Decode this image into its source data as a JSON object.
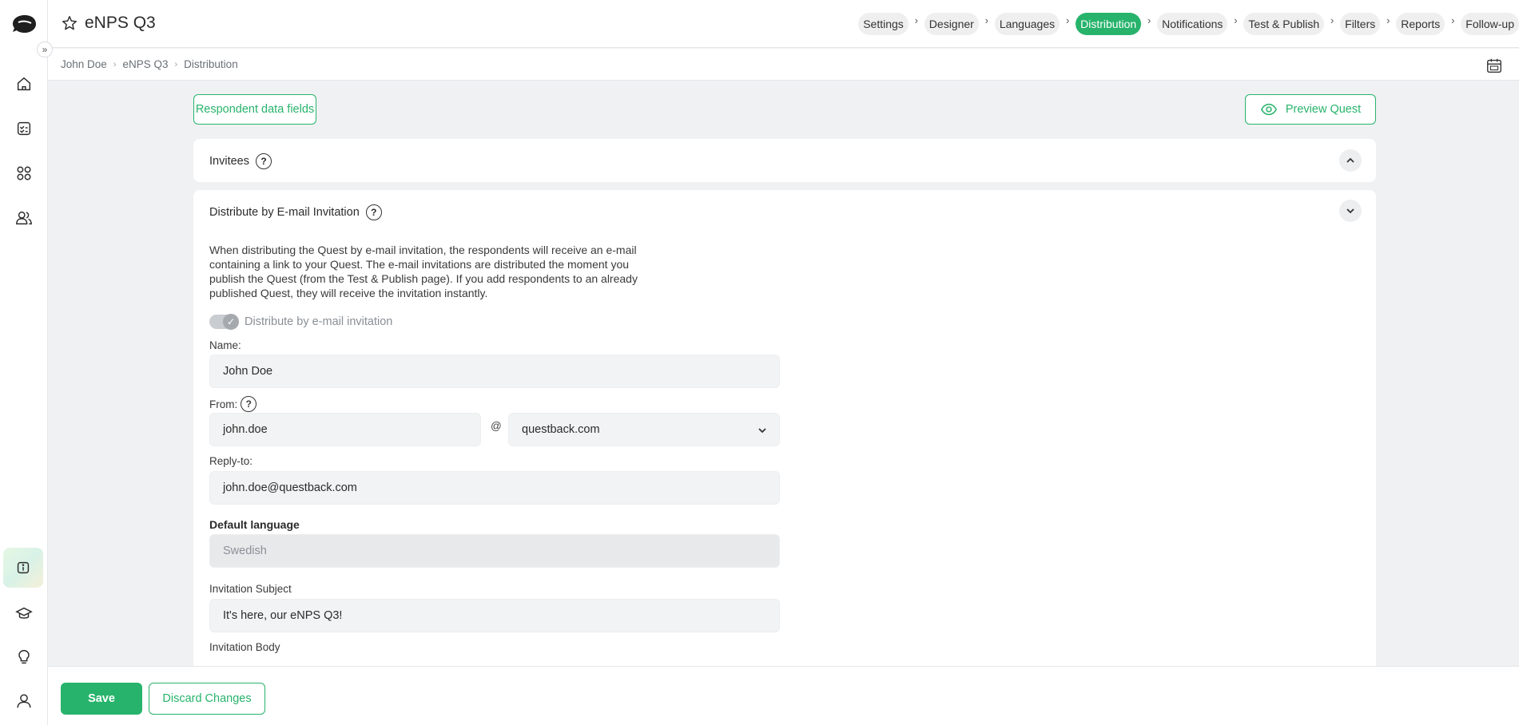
{
  "app": {
    "title": "eNPS Q3",
    "steps": [
      {
        "label": "Settings",
        "active": false
      },
      {
        "label": "Designer",
        "active": false
      },
      {
        "label": "Languages",
        "active": false
      },
      {
        "label": "Distribution",
        "active": true
      },
      {
        "label": "Notifications",
        "active": false
      },
      {
        "label": "Test & Publish",
        "active": false
      },
      {
        "label": "Filters",
        "active": false
      },
      {
        "label": "Reports",
        "active": false
      },
      {
        "label": "Follow-up",
        "active": false
      }
    ],
    "accent_color": "#27b36b"
  },
  "breadcrumb": [
    "John Doe",
    "eNPS Q3",
    "Distribution"
  ],
  "toolbar": {
    "respondent_fields_label": "Respondent data fields",
    "preview_label": "Preview Quest"
  },
  "invitees": {
    "title": "Invitees",
    "help": "?"
  },
  "email_distribution": {
    "title": "Distribute by E-mail Invitation",
    "help": "?",
    "description": "When distributing the Quest by e-mail invitation, the respondents will receive an e-mail containing a link to your Quest. The e-mail invitations are distributed the moment you publish the Quest (from the Test & Publish page). If you add respondents to an already published Quest, they will receive the invitation instantly.",
    "toggle_label": "Distribute by e-mail invitation",
    "toggle_on": true,
    "name_label": "Name:",
    "name_value": "John Doe",
    "from_label": "From:",
    "from_help": "?",
    "from_user": "john.doe",
    "at_sign": "@",
    "from_domain": "questback.com",
    "reply_to_label": "Reply-to:",
    "reply_to_value": "john.doe@questback.com",
    "default_language_label": "Default language",
    "default_language_value": "Swedish",
    "subject_label": "Invitation Subject",
    "subject_value": "It's here, our eNPS Q3!",
    "body_label": "Invitation Body"
  },
  "footer": {
    "save_label": "Save",
    "discard_label": "Discard Changes"
  },
  "icons": [
    "logo-icon",
    "expand-icon",
    "home-icon",
    "checklist-icon",
    "apps-icon",
    "users-icon",
    "info-icon",
    "graduation-cap-icon",
    "lightbulb-icon",
    "user-icon",
    "star-icon",
    "calendar-icon",
    "eye-icon",
    "help-icon",
    "chevron-up-icon",
    "chevron-down-icon",
    "check-icon"
  ]
}
